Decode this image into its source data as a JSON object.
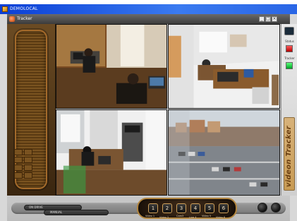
{
  "window": {
    "title": "DEMOLOCAL"
  },
  "app": {
    "title": "Tracker"
  },
  "window_controls": {
    "minimize": "_",
    "maximize": "□",
    "close": "×"
  },
  "right_panel": {
    "labels": {
      "status_top": "Status",
      "status_bottom": "Tracker"
    },
    "brand": "videon Tracker",
    "indicators": [
      {
        "color": "#d00000"
      },
      {
        "color": "#00b32c"
      }
    ]
  },
  "bottom": {
    "bar_labels": [
      "ON DRIVE",
      "MANUAL"
    ],
    "camera_buttons": [
      {
        "label": "1",
        "caption": "Video 1"
      },
      {
        "label": "2",
        "caption": "Video 2"
      },
      {
        "label": "3",
        "caption": "Cam3"
      },
      {
        "label": "4",
        "caption": "Live 4"
      },
      {
        "label": "5",
        "caption": "Video 5"
      },
      {
        "label": "6",
        "caption": "Video 6"
      }
    ]
  },
  "icons": {
    "window_system_icon": "window-icon",
    "tracker_icon": "tracker-icon",
    "monitor_icon": "monitor-icon"
  },
  "colors": {
    "window_title": "#2a66e6",
    "brand": "#c89b55"
  }
}
